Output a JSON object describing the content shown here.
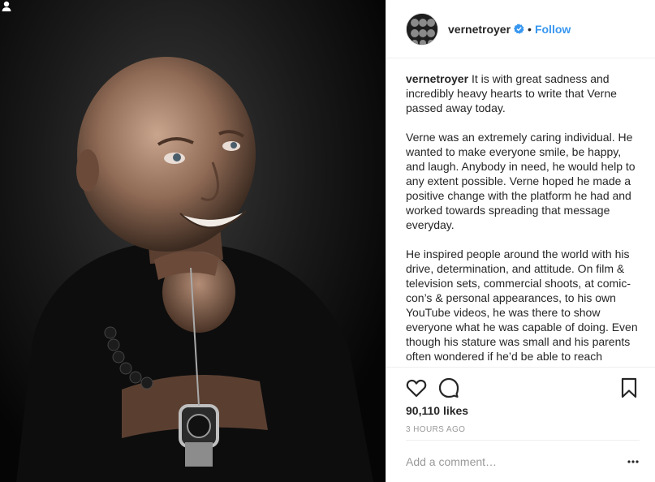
{
  "post": {
    "username": "vernetroyer",
    "follow_label": "Follow",
    "separator": "•",
    "caption_username": "vernetroyer",
    "caption_first": "It is with great sadness and incredibly heavy hearts to write that Verne passed away today.",
    "caption_second": "Verne was an extremely caring individual. He wanted to make everyone smile, be happy, and laugh. Anybody in need, he would help to any extent possible. Verne hoped he made a positive change with the platform he had and worked towards spreading that message everyday.",
    "caption_third": "He inspired people around the world with his drive, determination, and attitude. On film & television sets, commercial shoots, at comic-con’s & personal appearances, to his own YouTube videos, he was there to show everyone what he was capable of doing. Even though his stature was small and his parents often wondered if he’d be able to reach",
    "likes": "90,110 likes",
    "timestamp": "3 HOURS AGO",
    "comment_placeholder": "Add a comment…"
  },
  "icons": {
    "verified": "verified-badge-icon",
    "like": "heart-outline-icon",
    "comment": "speech-bubble-icon",
    "save": "bookmark-outline-icon",
    "more": "ellipsis-icon",
    "user_tag": "person-icon"
  },
  "colors": {
    "link_blue": "#3897f0",
    "verified_blue": "#3897f0",
    "border": "#efefef",
    "muted": "#999999",
    "text": "#262626"
  }
}
